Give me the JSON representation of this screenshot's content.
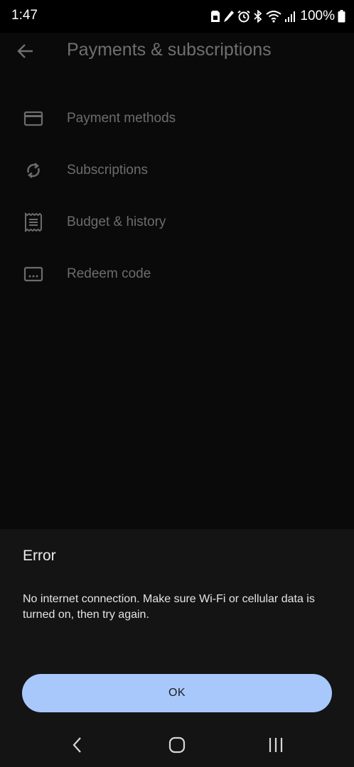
{
  "status_bar": {
    "time": "1:47",
    "battery_percent": "100%",
    "icons": [
      "sim-card-icon",
      "pen-icon",
      "alarm-icon",
      "bluetooth-icon",
      "wifi-icon",
      "signal-icon",
      "battery-icon"
    ]
  },
  "app": {
    "title": "Payments & subscriptions",
    "back_icon": "arrow-back-icon",
    "menu": [
      {
        "label": "Payment methods",
        "icon": "credit-card-icon"
      },
      {
        "label": "Subscriptions",
        "icon": "sync-icon"
      },
      {
        "label": "Budget & history",
        "icon": "receipt-icon"
      },
      {
        "label": "Redeem code",
        "icon": "redeem-code-icon"
      }
    ]
  },
  "dialog": {
    "title": "Error",
    "message": "No internet connection. Make sure Wi-Fi or cellular data is turned on, then try again.",
    "ok_label": "OK"
  },
  "nav_bar": {
    "buttons": [
      "back-icon",
      "home-icon",
      "recents-icon"
    ]
  },
  "colors": {
    "dialog_bg": "#141414",
    "ok_button": "#a8c8fb",
    "dimmed_text": "#6c6c6c"
  }
}
